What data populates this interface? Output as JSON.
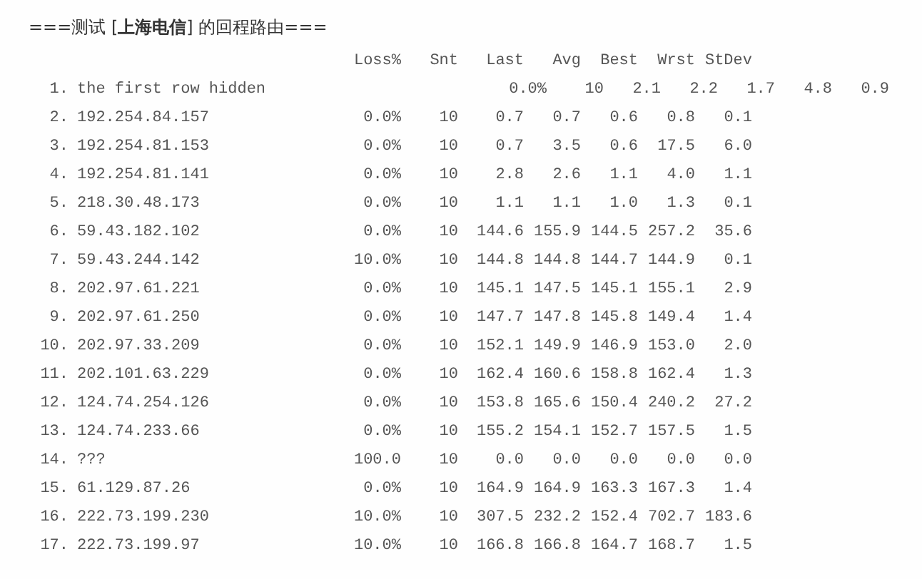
{
  "title": "===测试 [**上海电信**] 的回程路由===",
  "columns": [
    "Loss%",
    "Snt",
    "Last",
    "Avg",
    "Best",
    "Wrst",
    "StDev"
  ],
  "rows": [
    {
      "kind": "shifted",
      "number": "1.",
      "host": "the first row hidden",
      "values": [
        "0.0%",
        "10",
        "2.1",
        "2.2",
        "1.7",
        "4.8",
        "0.9"
      ]
    },
    {
      "kind": "plain",
      "number": "2.",
      "host": "192.254.84.157",
      "values": [
        "0.0%",
        "10",
        "0.7",
        "0.7",
        "0.6",
        "0.8",
        "0.1"
      ]
    },
    {
      "kind": "plain",
      "number": "3.",
      "host": "192.254.81.153",
      "values": [
        "0.0%",
        "10",
        "0.7",
        "3.5",
        "0.6",
        "17.5",
        "6.0"
      ]
    },
    {
      "kind": "plain",
      "number": "4.",
      "host": "192.254.81.141",
      "values": [
        "0.0%",
        "10",
        "2.8",
        "2.6",
        "1.1",
        "4.0",
        "1.1"
      ]
    },
    {
      "kind": "plain",
      "number": "5.",
      "host": "218.30.48.173",
      "values": [
        "0.0%",
        "10",
        "1.1",
        "1.1",
        "1.0",
        "1.3",
        "0.1"
      ]
    },
    {
      "kind": "plain",
      "number": "6.",
      "host": "59.43.182.102",
      "values": [
        "0.0%",
        "10",
        "144.6",
        "155.9",
        "144.5",
        "257.2",
        "35.6"
      ]
    },
    {
      "kind": "plain",
      "number": "7.",
      "host": "59.43.244.142",
      "values": [
        "10.0%",
        "10",
        "144.8",
        "144.8",
        "144.7",
        "144.9",
        "0.1"
      ]
    },
    {
      "kind": "plain",
      "number": "8.",
      "host": "202.97.61.221",
      "values": [
        "0.0%",
        "10",
        "145.1",
        "147.5",
        "145.1",
        "155.1",
        "2.9"
      ]
    },
    {
      "kind": "plain",
      "number": "9.",
      "host": "202.97.61.250",
      "values": [
        "0.0%",
        "10",
        "147.7",
        "147.8",
        "145.8",
        "149.4",
        "1.4"
      ]
    },
    {
      "kind": "plain",
      "number": "10.",
      "host": "202.97.33.209",
      "values": [
        "0.0%",
        "10",
        "152.1",
        "149.9",
        "146.9",
        "153.0",
        "2.0"
      ]
    },
    {
      "kind": "plain",
      "number": "11.",
      "host": "202.101.63.229",
      "values": [
        "0.0%",
        "10",
        "162.4",
        "160.6",
        "158.8",
        "162.4",
        "1.3"
      ]
    },
    {
      "kind": "plain",
      "number": "12.",
      "host": "124.74.254.126",
      "values": [
        "0.0%",
        "10",
        "153.8",
        "165.6",
        "150.4",
        "240.2",
        "27.2"
      ]
    },
    {
      "kind": "plain",
      "number": "13.",
      "host": "124.74.233.66",
      "values": [
        "0.0%",
        "10",
        "155.2",
        "154.1",
        "152.7",
        "157.5",
        "1.5"
      ]
    },
    {
      "kind": "plain",
      "number": "14.",
      "host": "???",
      "values": [
        "100.0",
        "10",
        "0.0",
        "0.0",
        "0.0",
        "0.0",
        "0.0"
      ]
    },
    {
      "kind": "plain",
      "number": "15.",
      "host": "61.129.87.26",
      "values": [
        "0.0%",
        "10",
        "164.9",
        "164.9",
        "163.3",
        "167.3",
        "1.4"
      ]
    },
    {
      "kind": "plain",
      "number": "16.",
      "host": "222.73.199.230",
      "values": [
        "10.0%",
        "10",
        "307.5",
        "232.2",
        "152.4",
        "702.7",
        "183.6"
      ]
    },
    {
      "kind": "plain",
      "number": "17.",
      "host": "222.73.199.97",
      "values": [
        "10.0%",
        "10",
        "166.8",
        "166.8",
        "164.7",
        "168.7",
        "1.5"
      ]
    }
  ]
}
